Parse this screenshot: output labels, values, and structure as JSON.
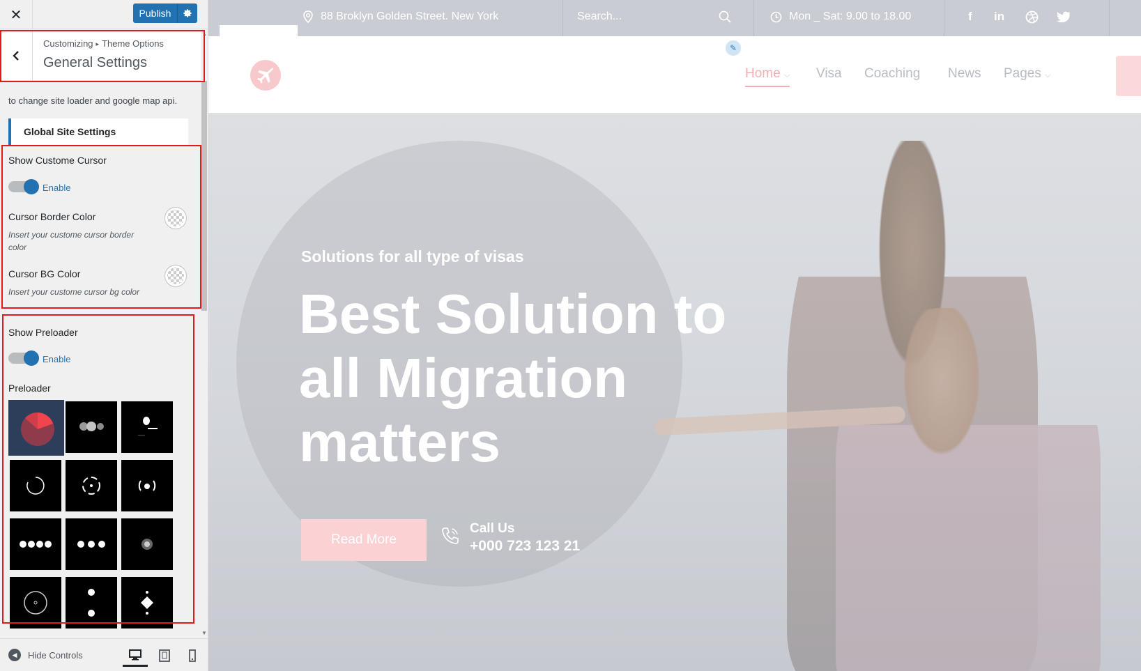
{
  "panel": {
    "close_glyph": "✕",
    "publish_label": "Publish",
    "crumb_root": "Customizing",
    "crumb_sep": "▸",
    "crumb_parent": "Theme Options",
    "section_title": "General Settings",
    "description": "to change site loader and google map api.",
    "global_heading": "Global Site Settings",
    "cursor": {
      "label": "Show Custome Cursor",
      "toggle_label": "Enable",
      "enabled": true,
      "border_color_label": "Cursor Border Color",
      "border_color_desc": "Insert your custome cursor border color",
      "bg_color_label": "Cursor BG Color",
      "bg_color_desc": "Insert your custome cursor bg color"
    },
    "preloader": {
      "label": "Show Preloader",
      "toggle_label": "Enable",
      "enabled": true,
      "picker_label": "Preloader",
      "selected_index": 0,
      "options": [
        "pie-spinner",
        "three-dots-grey",
        "dot-dash",
        "ring-spinner",
        "broken-ring",
        "pulse-ring",
        "four-dots",
        "three-dots",
        "glow-dot",
        "circle-dot",
        "two-dots-vertical",
        "diamond-dots"
      ]
    },
    "hide_controls_label": "Hide Controls"
  },
  "site": {
    "address": "88 Broklyn Golden Street. New York",
    "search_placeholder": "Search...",
    "hours": "Mon _ Sat: 9.00 to 18.00",
    "social": [
      "f",
      "in",
      "dribbble-icon",
      "twitter-icon"
    ],
    "nav": [
      "Home",
      "Visa",
      "Coaching",
      "News",
      "Pages"
    ],
    "hero_subtitle": "Solutions for all type of visas",
    "hero_title": "Best Solution to all Migration matters",
    "read_more": "Read More",
    "call_label": "Call Us",
    "call_number": "+000 723 123 21"
  },
  "colors": {
    "accent": "#2271b1",
    "brand_pink": "#f3aeb3",
    "highlight": "#e11b1b"
  }
}
